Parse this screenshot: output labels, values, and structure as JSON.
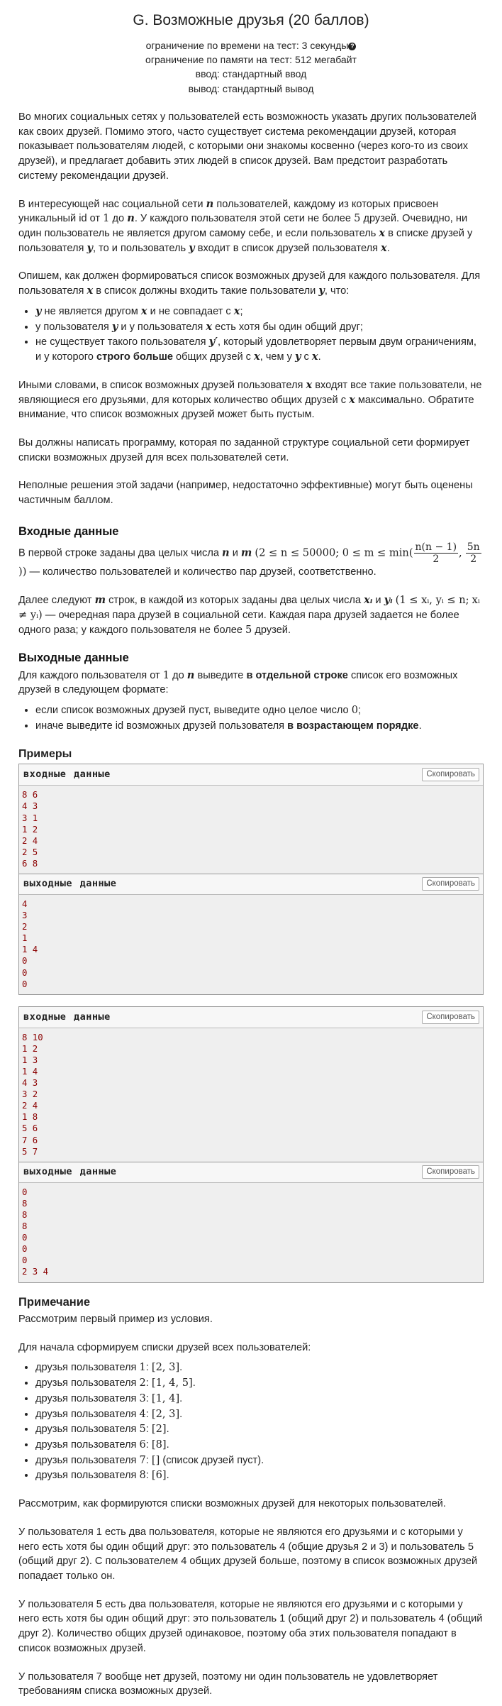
{
  "header": {
    "title": "G. Возможные друзья (20 баллов)",
    "time_limit": "ограничение по времени на тест: 3 секунды",
    "memory_limit": "ограничение по памяти на тест: 512 мегабайт",
    "input": "ввод: стандартный ввод",
    "output": "вывод: стандартный вывод"
  },
  "legend": {
    "p1": "Во многих социальных сетях у пользователей есть возможность указать других пользователей как своих друзей. Помимо этого, часто существует система рекомендации друзей, которая показывает пользователям людей, с которыми они знакомы косвенно (через кого-то из своих друзей), и предлагает добавить этих людей в список друзей. Вам предстоит разработать систему рекомендации друзей.",
    "p2": {
      "a": "В интересующей нас социальной сети ",
      "b": " пользователей, каждому из которых присвоен уникальный id от ",
      "c": " до ",
      "d": ". У каждого пользователя этой сети не более ",
      "e": " друзей. Очевидно, ни один пользователь не является другом самому себе, и если пользователь ",
      "f": " в списке друзей у пользователя ",
      "g": ", то и пользователь ",
      "h": " входит в список друзей пользователя ",
      "i": "."
    },
    "p3": {
      "a": "Опишем, как должен формироваться список возможных друзей для каждого пользователя. Для пользователя ",
      "b": " в список должны входить такие пользователи ",
      "c": ", что:"
    },
    "li1": {
      "a": " не является другом ",
      "b": " и не совпадает с ",
      "c": ";"
    },
    "li2": {
      "a": "у пользователя ",
      "b": " и у пользователя ",
      "c": " есть хотя бы один общий друг;"
    },
    "li3": {
      "a": "не существует такого пользователя ",
      "b": ", который удовлетворяет первым двум ограничениям, и у которого ",
      "strong": "строго больше",
      "c": " общих друзей с ",
      "d": ", чем у ",
      "e": " с ",
      "f": "."
    },
    "p4": {
      "a": "Иными словами, в список возможных друзей пользователя ",
      "b": " входят все такие пользователи, не являющиеся его друзьями, для которых количество общих друзей с ",
      "c": " максимально. Обратите внимание, что список возможных друзей может быть пустым."
    },
    "p5": "Вы должны написать программу, которая по заданной структуре социальной сети формирует списки возможных друзей для всех пользователей сети.",
    "p6": "Неполные решения этой задачи (например, недостаточно эффективные) могут быть оценены частичным баллом."
  },
  "input_spec": {
    "title": "Входные данные",
    "p1": {
      "a": "В первой строке заданы два целых числа ",
      "b": " и ",
      "c": " — количество пользователей и количество пар друзей, соответственно."
    },
    "p2": {
      "a": "Далее следуют ",
      "b": " строк, в каждой из которых заданы два целых числа ",
      "c": " и ",
      "d": " — очередная пара друзей в социальной сети. Каждая пара друзей задается не более одного раза; у каждого пользователя не более ",
      "e": " друзей."
    }
  },
  "output_spec": {
    "title": "Выходные данные",
    "p1": {
      "a": "Для каждого пользователя от ",
      "b": " до ",
      "c": " выведите ",
      "strong": "в отдельной строке",
      "d": " список его возможных друзей в следующем формате:"
    },
    "li1": {
      "a": "если список возможных друзей пуст, выведите одно целое число ",
      "b": ";"
    },
    "li2": {
      "a": "иначе выведите id возможных друзей пользователя ",
      "strong": "в возрастающем порядке",
      "b": "."
    }
  },
  "math": {
    "n": "n",
    "m": "m",
    "one": "1",
    "five": "5",
    "zero": "0",
    "x": "x",
    "y": "y",
    "yp": "y′",
    "xi": "xᵢ",
    "yi": "yᵢ",
    "neq": "xᵢ ≠ yᵢ",
    "c1_open": "(2 ≤ n ≤ 50000; 0 ≤ m ≤ min(",
    "c1_num1": "n(n − 1)",
    "c1_den1": "2",
    "c1_comma": ",",
    "c1_num2": "5n",
    "c1_den2": "2",
    "c1_close": "))",
    "c2": "(1 ≤ xᵢ, yᵢ ≤ n;",
    "c2b": "xᵢ ≠ yᵢ)"
  },
  "examples": {
    "title": "Примеры",
    "input_label": "входные данные",
    "output_label": "выходные данные",
    "copy_label": "Скопировать",
    "ex1_input": "8 6\n4 3\n3 1\n1 2\n2 4\n2 5\n6 8",
    "ex1_output": "4\n3\n2\n1\n1 4\n0\n0\n0",
    "ex2_input": "8 10\n1 2\n1 3\n1 4\n4 3\n3 2\n2 4\n1 8\n5 6\n7 6\n5 7",
    "ex2_output": "0\n8\n8\n8\n0\n0\n0\n2 3 4"
  },
  "note": {
    "title": "Примечание",
    "p1": "Рассмотрим первый пример из условия.",
    "p2": "Для начала сформируем списки друзей всех пользователей:",
    "friend_prefix": "друзья пользователя ",
    "empty_note": " (список друзей пуст).",
    "friends": [
      {
        "user": "1",
        "list": "[2, 3]"
      },
      {
        "user": "2",
        "list": "[1, 4, 5]"
      },
      {
        "user": "3",
        "list": "[1, 4]"
      },
      {
        "user": "4",
        "list": "[2, 3]"
      },
      {
        "user": "5",
        "list": "[2]"
      },
      {
        "user": "6",
        "list": "[8]"
      },
      {
        "user": "7",
        "list": "[]"
      },
      {
        "user": "8",
        "list": "[6]"
      }
    ],
    "p3": "Рассмотрим, как формируются списки возможных друзей для некоторых пользователей.",
    "p4": "У пользователя 1 есть два пользователя, которые не являются его друзьями и с которыми у него есть хотя бы один общий друг: это пользователь 4 (общие друзья 2 и 3) и пользователь 5 (общий друг 2). С пользователем 4 общих друзей больше, поэтому в список возможных друзей попадает только он.",
    "p5": "У пользователя 5 есть два пользователя, которые не являются его друзьями и с которыми у него есть хотя бы один общий друг: это пользователь 1 (общий друг 2) и пользователь 4 (общий друг 2). Количество общих друзей одинаковое, поэтому оба этих пользователя попадают в список возможных друзей.",
    "p6": "У пользователя 7 вообще нет друзей, поэтому ни один пользователь не удовлетворяет требованиям списка возможных друзей."
  }
}
